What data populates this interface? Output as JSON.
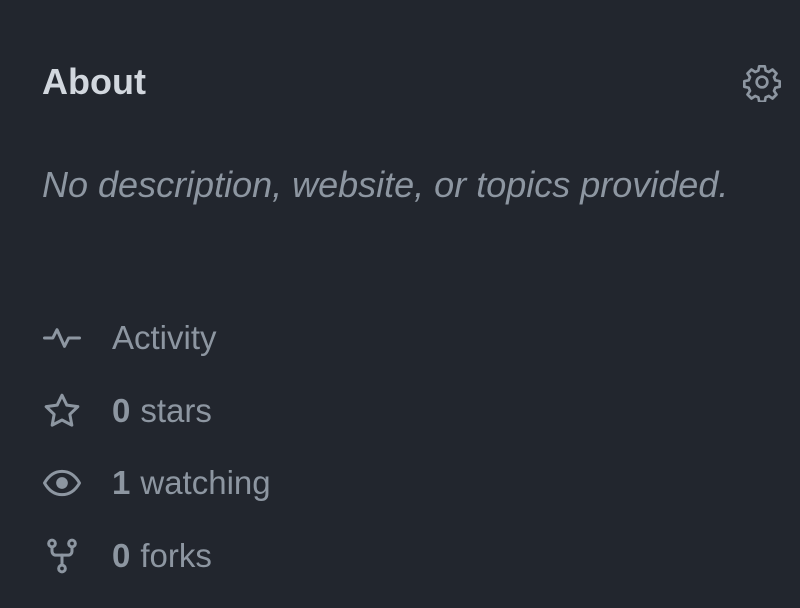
{
  "about": {
    "title": "About",
    "description": "No description, website, or topics provided.",
    "settings_icon": "gear-icon"
  },
  "stats": [
    {
      "icon": "pulse-icon",
      "count": "",
      "label": "Activity"
    },
    {
      "icon": "star-icon",
      "count": "0",
      "label": "stars"
    },
    {
      "icon": "eye-icon",
      "count": "1",
      "label": "watching"
    },
    {
      "icon": "repo-forked-icon",
      "count": "0",
      "label": "forks"
    }
  ],
  "colors": {
    "background": "#22262e",
    "title": "#d2d7de",
    "muted": "#8d96a1"
  }
}
